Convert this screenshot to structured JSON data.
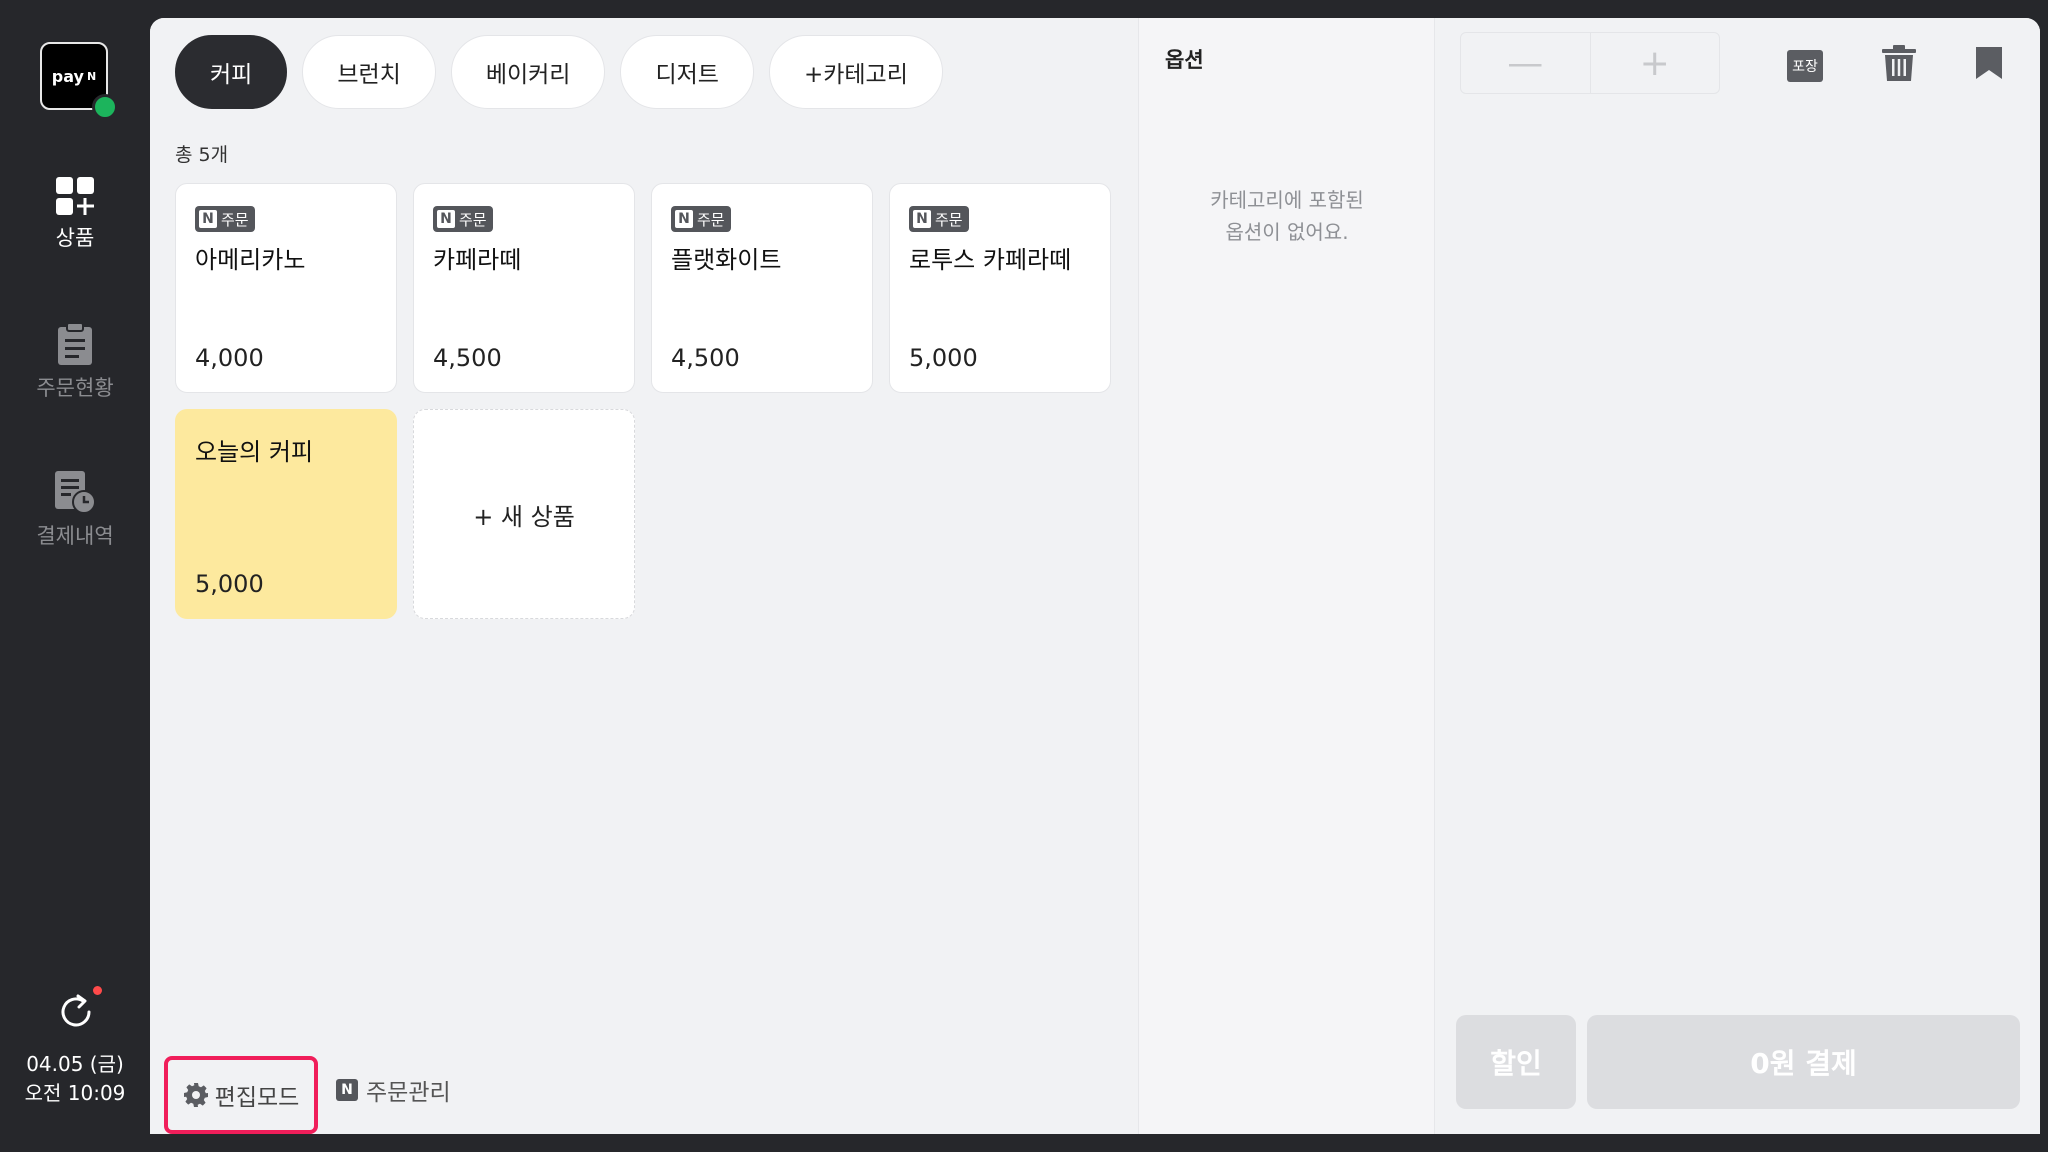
{
  "sidebar": {
    "logo": {
      "text": "pay",
      "suffix": "N"
    },
    "items": [
      {
        "label": "상품",
        "icon": "grid-plus-icon",
        "active": true
      },
      {
        "label": "주문현황",
        "icon": "clipboard-icon",
        "active": false
      },
      {
        "label": "결제내역",
        "icon": "receipt-clock-icon",
        "active": false
      }
    ],
    "date": "04.05 (금)",
    "time": "오전 10:09",
    "status_color": "#1cb45c",
    "notification_color": "#ff4a4a"
  },
  "categories": [
    {
      "label": "커피",
      "active": true
    },
    {
      "label": "브런치",
      "active": false
    },
    {
      "label": "베이커리",
      "active": false
    },
    {
      "label": "디저트",
      "active": false
    },
    {
      "label": "+카테고리",
      "active": false
    }
  ],
  "product_count": "총 5개",
  "badge": {
    "n": "N",
    "label": "주문"
  },
  "products": [
    {
      "name": "아메리카노",
      "price": "4,000"
    },
    {
      "name": "카페라떼",
      "price": "4,500"
    },
    {
      "name": "플랫화이트",
      "price": "4,500"
    },
    {
      "name": "로투스 카페라떼",
      "price": "5,000"
    },
    {
      "name": "오늘의 커피",
      "price": "5,000"
    }
  ],
  "new_product_label": "+ 새 상품",
  "bottom": {
    "edit_mode": "편집모드",
    "order_mgmt_n": "N",
    "order_mgmt": "주문관리"
  },
  "options": {
    "title": "옵션",
    "empty_line1": "카테고리에 포함된",
    "empty_line2": "옵션이 없어요."
  },
  "cart": {
    "minus": "—",
    "plus": "+",
    "pack_label": "포장",
    "discount": "할인",
    "pay": "0원 결제"
  },
  "colors": {
    "accent_highlight": "#f01e5a",
    "yellow_card": "#fde99e"
  }
}
